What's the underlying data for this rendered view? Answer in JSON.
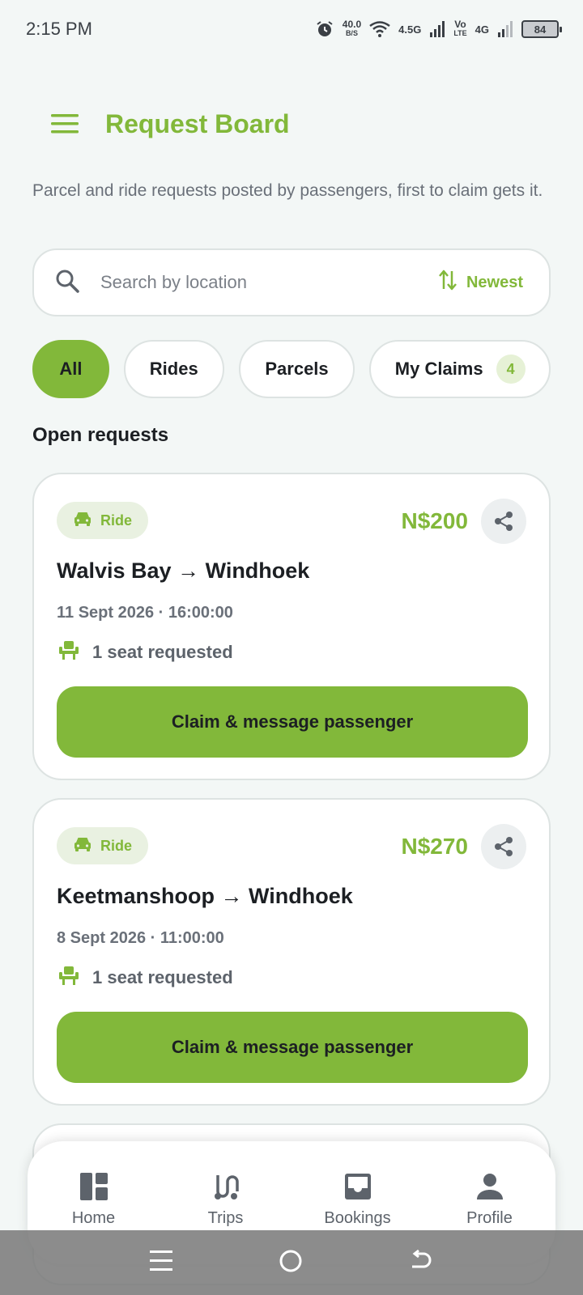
{
  "status_bar": {
    "time": "2:15 PM",
    "net_speed_value": "40.0",
    "net_speed_unit": "B/S",
    "network1": "4.5G",
    "volte_top": "Vo",
    "volte_bottom": "LTE",
    "network2": "4G",
    "battery": "84"
  },
  "header": {
    "title": "Request Board"
  },
  "subtitle": "Parcel and ride requests posted by passengers, first to claim gets it.",
  "search": {
    "placeholder": "Search by location",
    "sort_label": "Newest"
  },
  "filters": {
    "all": "All",
    "rides": "Rides",
    "parcels": "Parcels",
    "my_claims": "My Claims",
    "my_claims_count": "4",
    "active": "All"
  },
  "section_title": "Open requests",
  "requests": [
    {
      "type": "Ride",
      "price": "N$200",
      "route": "Walvis Bay → Windhoek",
      "datetime": "11 Sept 2026 · 16:00:00",
      "seats": "1 seat requested",
      "action": "Claim & message passenger"
    },
    {
      "type": "Ride",
      "price": "N$270",
      "route": "Keetmanshoop → Windhoek",
      "datetime": "8 Sept 2026 · 11:00:00",
      "seats": "1 seat requested",
      "action": "Claim & message passenger"
    }
  ],
  "bottom_nav": {
    "home": "Home",
    "trips": "Trips",
    "bookings": "Bookings",
    "profile": "Profile"
  },
  "colors": {
    "accent": "#82b83a",
    "background": "#f3f7f6",
    "text_muted": "#6a7079"
  }
}
